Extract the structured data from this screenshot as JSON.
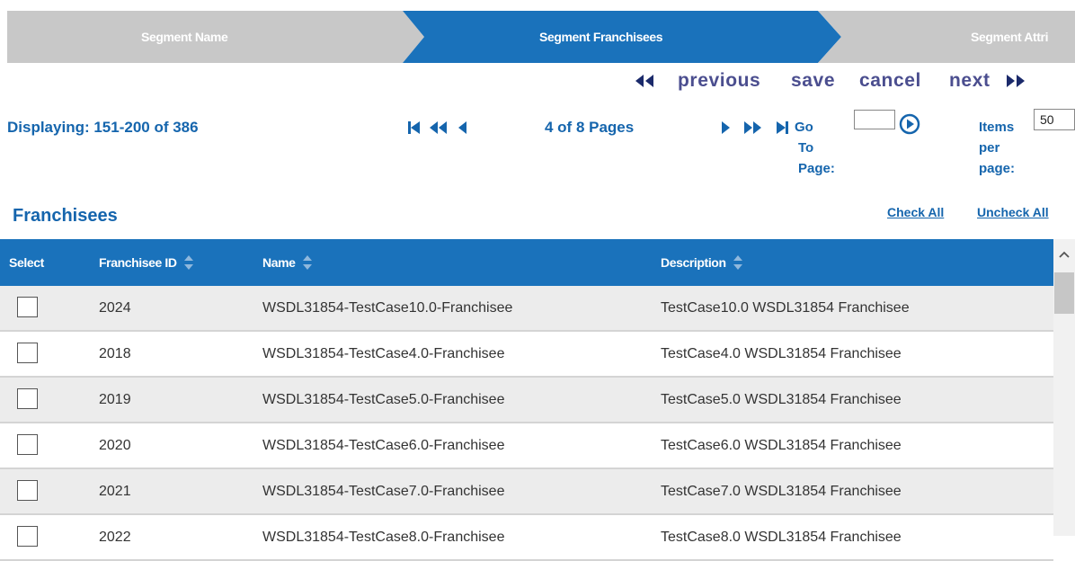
{
  "wizard": {
    "steps": [
      {
        "label": "Segment Name",
        "state": "inactive"
      },
      {
        "label": "Segment Franchisees",
        "state": "active"
      },
      {
        "label": "Segment Attri",
        "state": "inactive"
      }
    ],
    "colors": {
      "active": "#1a72bb",
      "inactive": "#c8c8c8"
    }
  },
  "actions": {
    "previous_label": "previous",
    "save_label": "save",
    "cancel_label": "cancel",
    "next_label": "next"
  },
  "pager": {
    "displaying": "Displaying: 151-200 of 386",
    "page_status": "4 of 8 Pages",
    "goto_line1": "Go",
    "goto_line2": "To",
    "goto_line3": "Page:",
    "goto_value": "",
    "items_line1": "Items",
    "items_line2": "per",
    "items_line3": "page:",
    "items_value": "50"
  },
  "section": {
    "title": "Franchisees",
    "check_all": "Check All",
    "uncheck_all": "Uncheck All"
  },
  "table": {
    "columns": [
      "Select",
      "Franchisee ID",
      "Name",
      "Description"
    ],
    "rows": [
      {
        "id": "2024",
        "name": "WSDL31854-TestCase10.0-Franchisee",
        "description": "TestCase10.0 WSDL31854 Franchisee",
        "checked": false
      },
      {
        "id": "2018",
        "name": "WSDL31854-TestCase4.0-Franchisee",
        "description": "TestCase4.0 WSDL31854 Franchisee",
        "checked": false
      },
      {
        "id": "2019",
        "name": "WSDL31854-TestCase5.0-Franchisee",
        "description": "TestCase5.0 WSDL31854 Franchisee",
        "checked": false
      },
      {
        "id": "2020",
        "name": "WSDL31854-TestCase6.0-Franchisee",
        "description": "TestCase6.0 WSDL31854 Franchisee",
        "checked": false
      },
      {
        "id": "2021",
        "name": "WSDL31854-TestCase7.0-Franchisee",
        "description": "TestCase7.0 WSDL31854 Franchisee",
        "checked": false
      },
      {
        "id": "2022",
        "name": "WSDL31854-TestCase8.0-Franchisee",
        "description": "TestCase8.0 WSDL31854 Franchisee",
        "checked": false
      }
    ]
  },
  "icons": {
    "first_page": "first-page-icon",
    "prev_set": "rewind-icon",
    "prev_page": "prev-page-icon",
    "next_page": "next-page-icon",
    "next_set": "fast-forward-icon",
    "last_page": "last-page-icon",
    "go": "go-circle-icon",
    "sort": "sort-icon",
    "scroll_up": "scroll-up-icon"
  },
  "colors": {
    "header_blue": "#1a72bb",
    "link_blue": "#1565ad",
    "action_purple": "#4b4e8f",
    "row_alt": "#ececec"
  }
}
